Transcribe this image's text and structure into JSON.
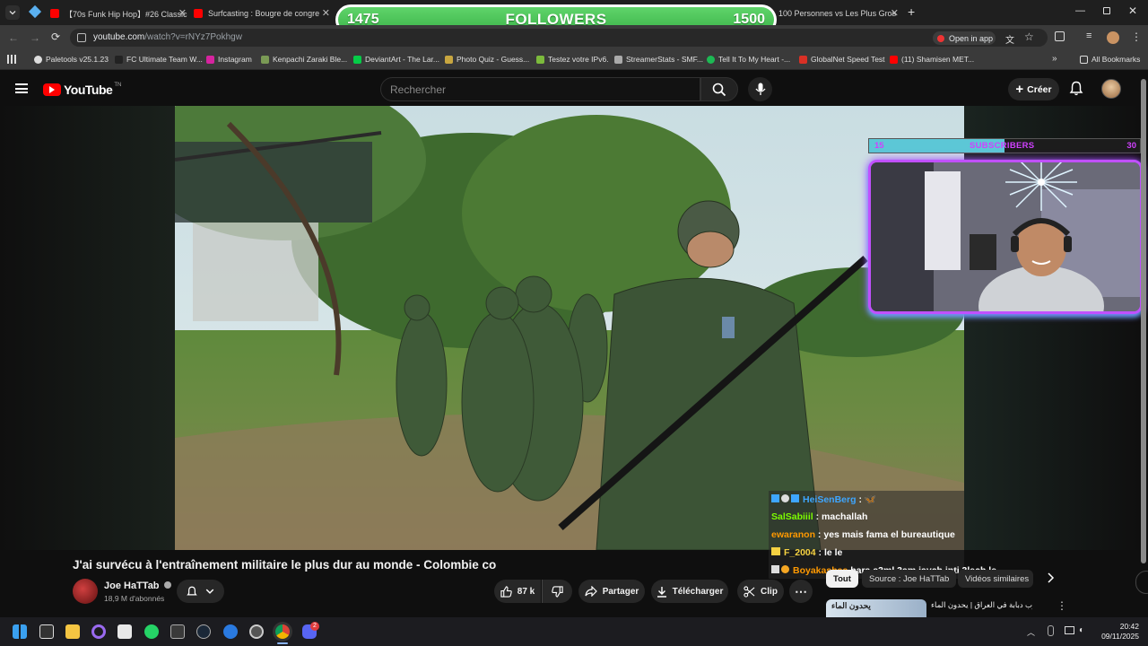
{
  "tabs": [
    {
      "label": "【70s Funk Hip Hop】#26 Classic"
    },
    {
      "label": "Surfcasting : Bougre de congre"
    },
    {
      "label": "100 Personnes vs Les Plus Gros"
    }
  ],
  "followers_overlay": {
    "current": "1475",
    "label": "FOLLOWERS",
    "goal": "1500"
  },
  "address_bar": {
    "host": "youtube.com",
    "path": "/watch?v=rNYz7Pokhgw",
    "open_in_app": "Open in app"
  },
  "bookmarks": [
    {
      "label": "Paletools v25.1.23"
    },
    {
      "label": "FC Ultimate Team W..."
    },
    {
      "label": "Instagram"
    },
    {
      "label": "Kenpachi Zaraki Ble..."
    },
    {
      "label": "DeviantArt - The Lar..."
    },
    {
      "label": "Photo Quiz - Guess..."
    },
    {
      "label": "Testez votre IPv6."
    },
    {
      "label": "StreamerStats - SMF..."
    },
    {
      "label": "Tell It To My Heart -..."
    },
    {
      "label": "GlobalNet Speed Test"
    },
    {
      "label": "(11) Shamisen MET..."
    },
    {
      "label": "All Bookmarks"
    }
  ],
  "youtube": {
    "logo": "YouTube",
    "logo_region": "TN",
    "search_placeholder": "Rechercher",
    "create_label": "Créer"
  },
  "subscribers_overlay": {
    "current": "15",
    "label": "SUBSCRIBERS",
    "goal": "30",
    "progress": 0.5
  },
  "chat": [
    {
      "user": "HeiSenBerg",
      "message": "🦋",
      "user_color": "#3ea6ff"
    },
    {
      "user": "SalSabiiil",
      "message": "machallah",
      "user_color": "#7cfc00"
    },
    {
      "user": "ewaranon",
      "message": "yes mais fama el bureautique",
      "user_color": "#ff9900"
    },
    {
      "user": "F_2004",
      "message": "le le",
      "user_color": "#f5d142"
    },
    {
      "user": "Boyakashaa",
      "message": "bara a3ml 3am jaych inti 3lech le",
      "user_color": "#ff9900"
    }
  ],
  "video": {
    "title": "J'ai survécu à l'entraînement militaire le plus dur au monde - Colombie co",
    "channel": "Joe HaTTab",
    "subscribers": "18,9 M d'abonnés",
    "likes": "87 k",
    "share": "Partager",
    "download": "Télécharger",
    "clip": "Clip"
  },
  "filters": {
    "all": "Tout",
    "source": "Source : Joe HaTTab",
    "similar": "Vidéos similaires"
  },
  "suggestion": {
    "title": "أعرب دبابة في العراق | يحدون الماء!",
    "thumb_text": "يحدون الماء"
  },
  "clock": {
    "time": "20:42",
    "date": "09/11/2025"
  },
  "discord_badge": "2"
}
